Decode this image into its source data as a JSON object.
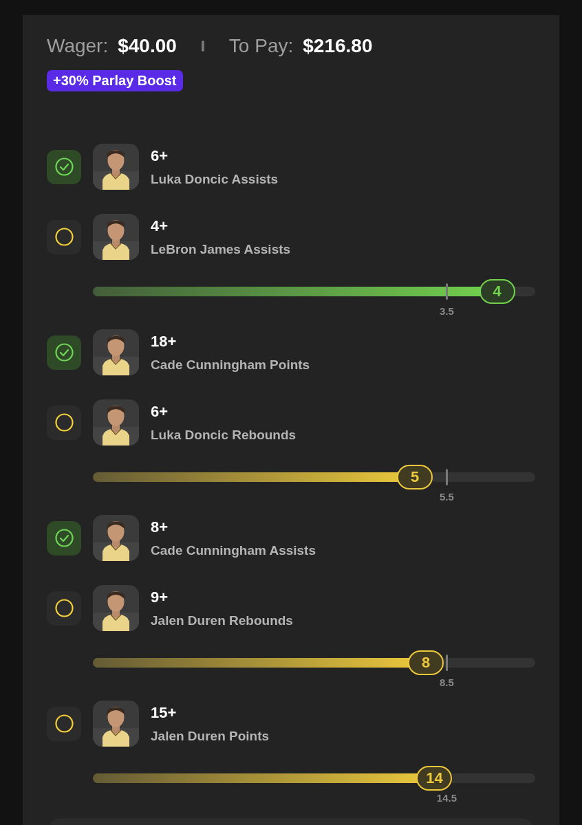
{
  "summary": {
    "wager_label": "Wager:",
    "wager": "$40.00",
    "to_pay_label": "To Pay:",
    "to_pay": "$216.80",
    "boost": "+30% Parlay Boost"
  },
  "legs": [
    {
      "checked": true,
      "line": "6+",
      "market": "Luka Doncic Assists"
    },
    {
      "checked": false,
      "line": "4+",
      "market": "LeBron James Assists",
      "progress": {
        "level": 0.914,
        "current": "4",
        "target": "3.5",
        "color": "#72d24e"
      }
    },
    {
      "checked": true,
      "line": "18+",
      "market": "Cade Cunningham Points"
    },
    {
      "checked": false,
      "line": "6+",
      "market": "Luka Doncic Rebounds",
      "progress": {
        "level": 0.728,
        "current": "5",
        "target": "5.5",
        "color": "#ecc93c"
      }
    },
    {
      "checked": true,
      "line": "8+",
      "market": "Cade Cunningham Assists"
    },
    {
      "checked": false,
      "line": "9+",
      "market": "Jalen Duren Rebounds",
      "progress": {
        "level": 0.753,
        "current": "8",
        "target": "8.5",
        "color": "#ecc93c"
      }
    },
    {
      "checked": false,
      "line": "15+",
      "market": "Jalen Duren Points",
      "progress": {
        "level": 0.772,
        "current": "14",
        "target": "14.5",
        "color": "#ecc93c"
      }
    }
  ]
}
